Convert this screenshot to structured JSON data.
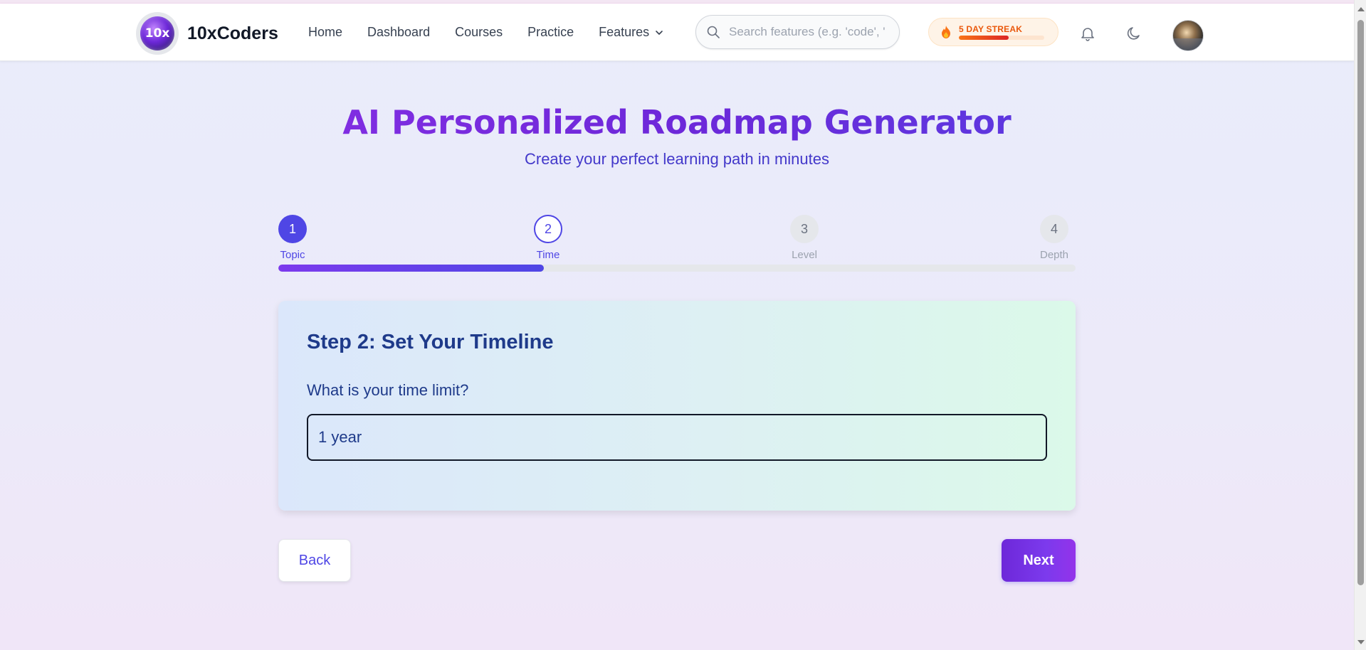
{
  "header": {
    "brand": "10xCoders",
    "logo_text": "10x",
    "nav": [
      "Home",
      "Dashboard",
      "Courses",
      "Practice",
      "Features"
    ],
    "search_placeholder": "Search features (e.g. 'code', '",
    "streak_label": "5 DAY STREAK",
    "streak_progress": 0.58
  },
  "hero": {
    "title": "AI Personalized Roadmap Generator",
    "subtitle": "Create your perfect learning path in minutes"
  },
  "stepper": {
    "steps": [
      {
        "number": "1",
        "label": "Topic",
        "state": "done"
      },
      {
        "number": "2",
        "label": "Time",
        "state": "current"
      },
      {
        "number": "3",
        "label": "Level",
        "state": "todo"
      },
      {
        "number": "4",
        "label": "Depth",
        "state": "todo"
      }
    ],
    "progress_fraction": 0.333
  },
  "card": {
    "title": "Step 2: Set Your Timeline",
    "question": "What is your time limit?",
    "input_value": "1 year"
  },
  "actions": {
    "back": "Back",
    "next": "Next"
  },
  "colors": {
    "accent": "#4f46e5",
    "title_gradient_start": "#9333ea",
    "title_gradient_end": "#4f46e5",
    "streak": "#ea580c"
  }
}
